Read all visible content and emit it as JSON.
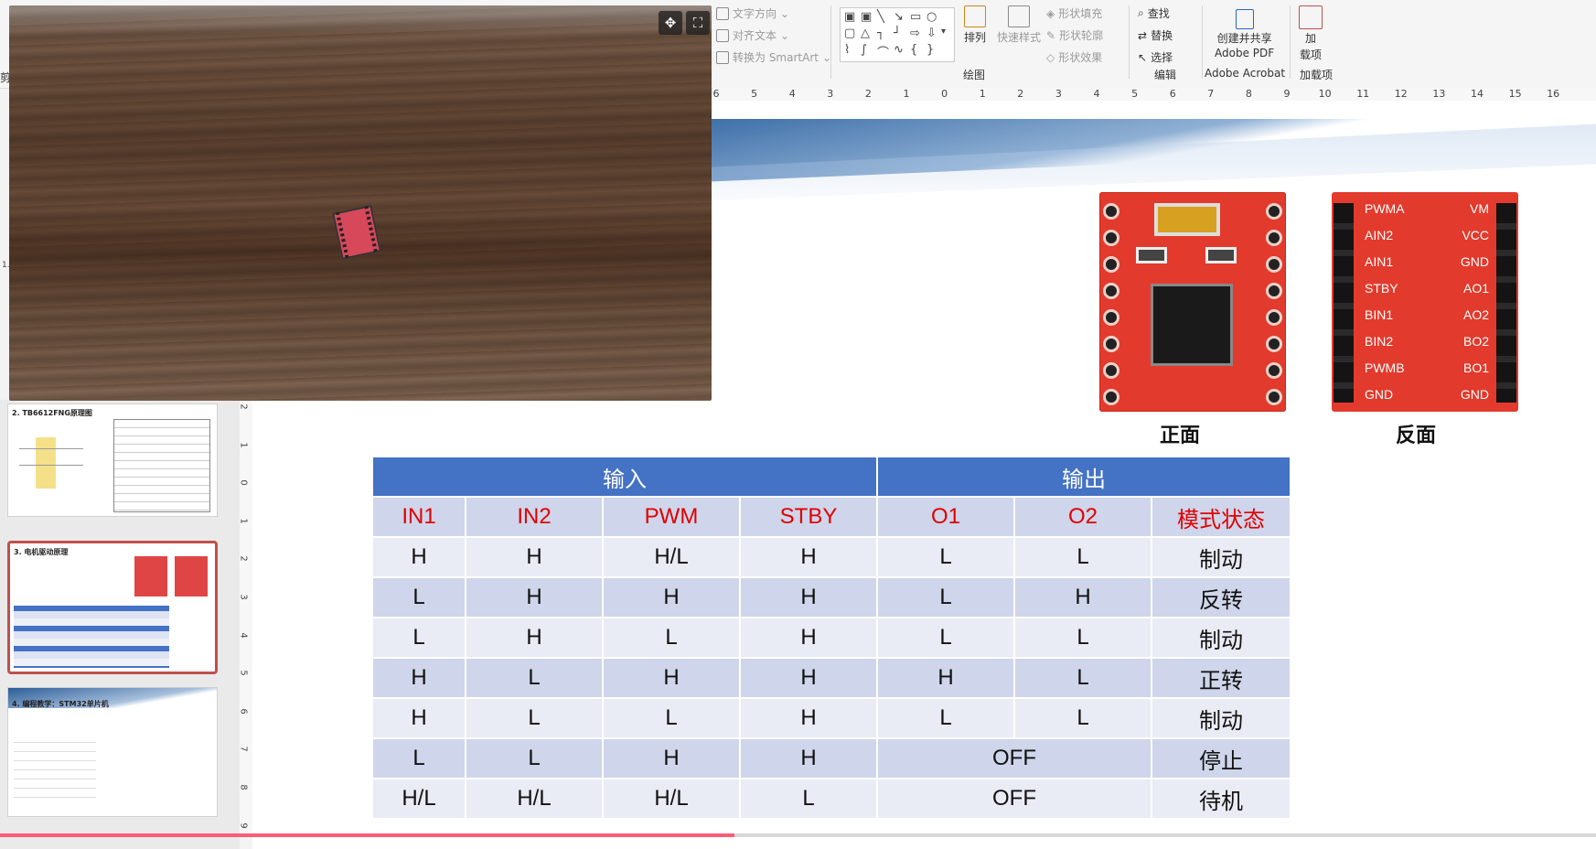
{
  "ribbon": {
    "text_direction": "文字方向",
    "align_text": "对齐文本",
    "convert_smartart": "转换为 SmartArt",
    "arrange": "排列",
    "quick_styles": "快速样式",
    "shape_fill": "形状填充",
    "shape_outline": "形状轮廓",
    "shape_effects": "形状效果",
    "find": "查找",
    "replace": "替换",
    "select": "选择",
    "create_share_line1": "创建并共享",
    "create_share_line2": "Adobe PDF",
    "addins_line1": "加",
    "addins_line2": "载项",
    "group_drawing": "绘图",
    "group_editing": "编辑",
    "group_acrobat": "Adobe Acrobat",
    "group_addins": "加载项",
    "left_clip": "剪"
  },
  "ruler": {
    "ticks": [
      "6",
      "5",
      "4",
      "3",
      "2",
      "1",
      "0",
      "1",
      "2",
      "3",
      "4",
      "5",
      "6",
      "7",
      "8",
      "9",
      "10",
      "11",
      "12",
      "13",
      "14",
      "15",
      "16"
    ],
    "vticks": [
      "2",
      "1",
      "0",
      "1",
      "2",
      "3",
      "4",
      "5",
      "6",
      "7",
      "8",
      "9"
    ]
  },
  "thumbnails": [
    {
      "number": "",
      "title": "2. TB6612FNG原理图"
    },
    {
      "number": "",
      "title": "3. 电机驱动原理"
    },
    {
      "number": "",
      "title": "4. 编程教学：STM32单片机"
    }
  ],
  "thumb_left_numbers": [
    "1."
  ],
  "slide": {
    "front_caption": "正面",
    "back_caption": "反面",
    "back_pins_left": [
      "PWMA",
      "AIN2",
      "AIN1",
      "STBY",
      "BIN1",
      "BIN2",
      "PWMB",
      "GND"
    ],
    "back_pins_right": [
      "VM",
      "VCC",
      "GND",
      "AO1",
      "AO2",
      "BO2",
      "BO1",
      "GND"
    ],
    "table": {
      "group_input": "输入",
      "group_output": "输出",
      "headers": [
        "IN1",
        "IN2",
        "PWM",
        "STBY",
        "O1",
        "O2",
        "模式状态"
      ],
      "rows": [
        [
          "H",
          "H",
          "H/L",
          "H",
          "L",
          "L",
          "制动"
        ],
        [
          "L",
          "H",
          "H",
          "H",
          "L",
          "H",
          "反转"
        ],
        [
          "L",
          "H",
          "L",
          "H",
          "L",
          "L",
          "制动"
        ],
        [
          "H",
          "L",
          "H",
          "H",
          "H",
          "L",
          "正转"
        ],
        [
          "H",
          "L",
          "L",
          "H",
          "L",
          "L",
          "制动"
        ]
      ],
      "merged_rows": [
        [
          "L",
          "L",
          "H",
          "H",
          "OFF",
          "停止"
        ],
        [
          "H/L",
          "H/L",
          "H/L",
          "L",
          "OFF",
          "待机"
        ]
      ]
    }
  },
  "video": {
    "move_icon": "move-icon",
    "fullscreen_icon": "fullscreen-icon"
  },
  "playback": {
    "progress": 0.46
  }
}
